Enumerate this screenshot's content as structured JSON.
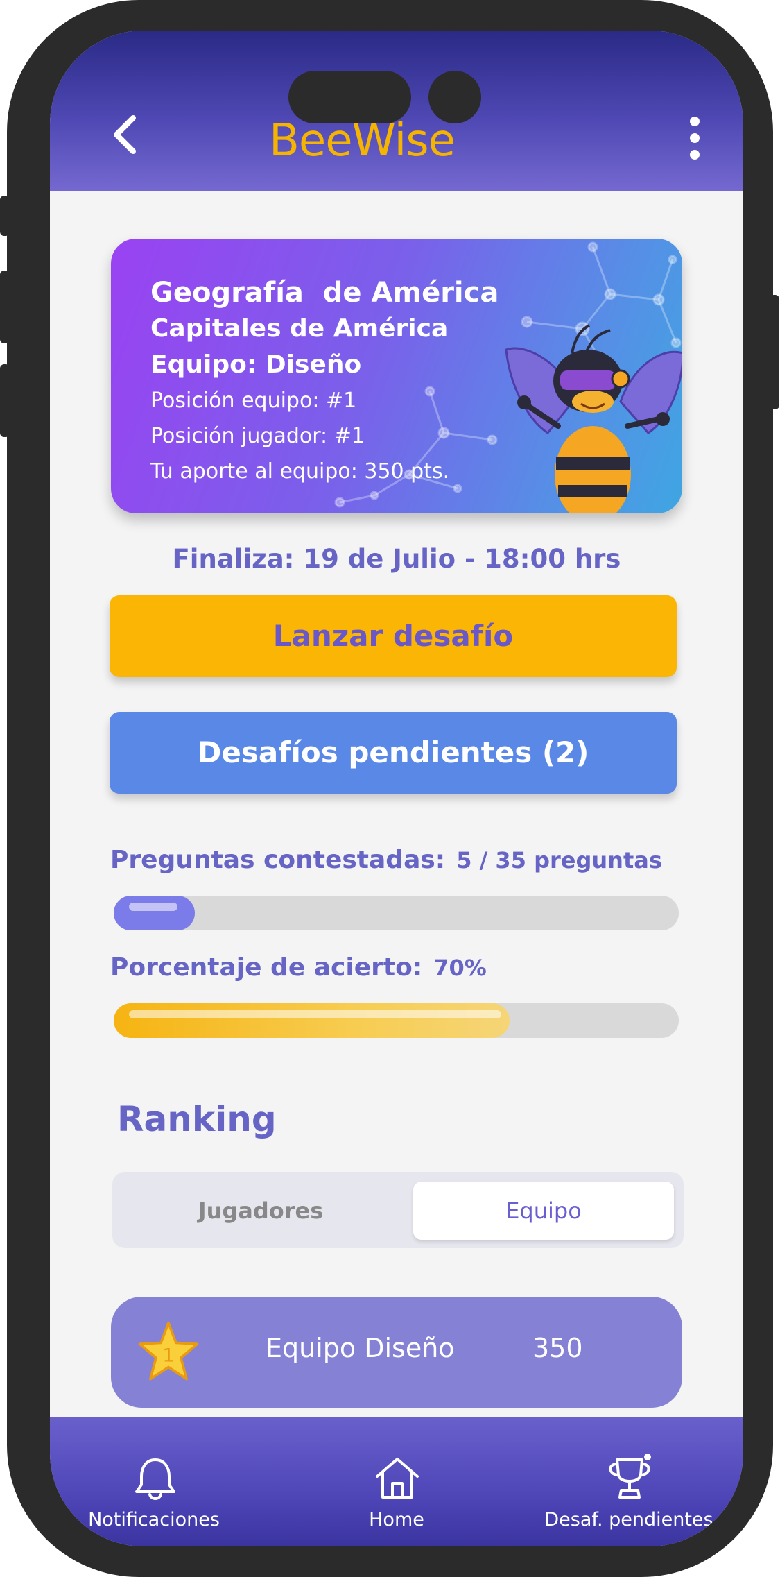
{
  "app": {
    "logo": "BeeWise"
  },
  "card": {
    "subject": "Geografía  de América",
    "topic": "Capitales de América",
    "team": "Equipo: Diseño",
    "team_position": "Posición equipo:  #1",
    "player_position": "Posición jugador: #1",
    "contribution": "Tu aporte al equipo: 350 pts."
  },
  "deadline": "Finaliza: 19 de Julio - 18:00 hrs",
  "buttons": {
    "launch": "Lanzar desafío",
    "pending": "Desafíos pendientes (2)"
  },
  "progress": {
    "questions_label": "Preguntas contestadas:",
    "questions_value": "5 / 35 preguntas",
    "questions_fraction": 0.143,
    "accuracy_label": "Porcentaje de acierto:",
    "accuracy_value": "70%",
    "accuracy_fraction": 0.7
  },
  "ranking": {
    "title": "Ranking",
    "tabs": [
      "Jugadores",
      "Equipo"
    ],
    "selected_tab": "Equipo",
    "rows": [
      {
        "rank": "1",
        "name": "Equipo Diseño",
        "score": "350"
      }
    ]
  },
  "tabbar": {
    "notifications": "Notificaciones",
    "home": "Home",
    "pending": "Desaf. pendientes"
  },
  "colors": {
    "accent_purple": "#6664c4",
    "launch_yellow": "#fbb605",
    "pending_blue": "#5988e6",
    "ranking_row": "#8582d6"
  },
  "icons": {
    "back": "chevron-left-icon",
    "menu": "more-vertical-icon",
    "rank": "star-icon",
    "notifications": "bell-icon",
    "home": "home-icon",
    "pending": "trophy-icon"
  }
}
